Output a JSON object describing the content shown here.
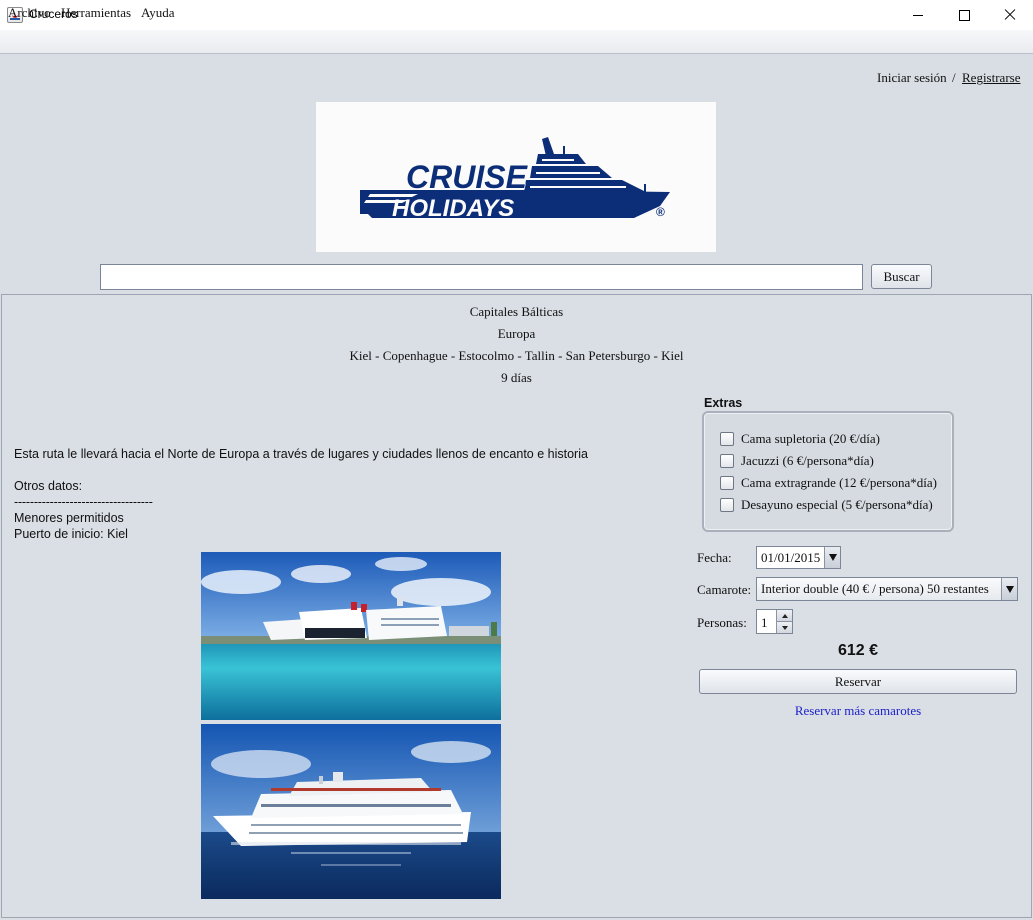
{
  "window": {
    "title": "Cruceros",
    "icon": "java-app-icon"
  },
  "menu": {
    "items": [
      "Archivo",
      "Herramientas",
      "Ayuda"
    ]
  },
  "header": {
    "login_label": "Iniciar sesión",
    "separator": "/",
    "register_label": "Registrarse",
    "logo_text_line1": "CRUISE",
    "logo_text_line2": "HOLIDAYS",
    "logo_mark": "®",
    "logo_color": "#0c2d78"
  },
  "search": {
    "value": "",
    "placeholder": "",
    "button_label": "Buscar"
  },
  "cruise": {
    "name": "Capitales Bálticas",
    "region": "Europa",
    "ports": "Kiel - Copenhague - Estocolmo - Tallin - San Petersburgo - Kiel",
    "duration": "9 días",
    "description": "Esta ruta le llevará hacia el Norte de Europa a través de lugares y ciudades llenos de encanto e historia",
    "other_title": "Otros datos:",
    "divider": "-----------------------------------",
    "minors": "Menores permitidos",
    "start_port": "Puerto de inicio: Kiel"
  },
  "extras": {
    "title": "Extras",
    "items": [
      {
        "label": "Cama supletoria (20 €/día)",
        "checked": false
      },
      {
        "label": "Jacuzzi (6 €/persona*día)",
        "checked": false
      },
      {
        "label": "Cama extragrande (12 €/persona*día)",
        "checked": false
      },
      {
        "label": "Desayuno especial (5 €/persona*día)",
        "checked": false
      }
    ]
  },
  "form": {
    "fecha_label": "Fecha:",
    "fecha_value": "01/01/2015",
    "camarote_label": "Camarote:",
    "camarote_value": "Interior double (40 € / persona) 50 restantes",
    "personas_label": "Personas:",
    "personas_value": "1"
  },
  "price": "612 €",
  "reserve_label": "Reservar",
  "more_cabins_link": "Reservar más camarotes",
  "colors": {
    "background": "#d9dde4",
    "link": "#1d22c8"
  }
}
